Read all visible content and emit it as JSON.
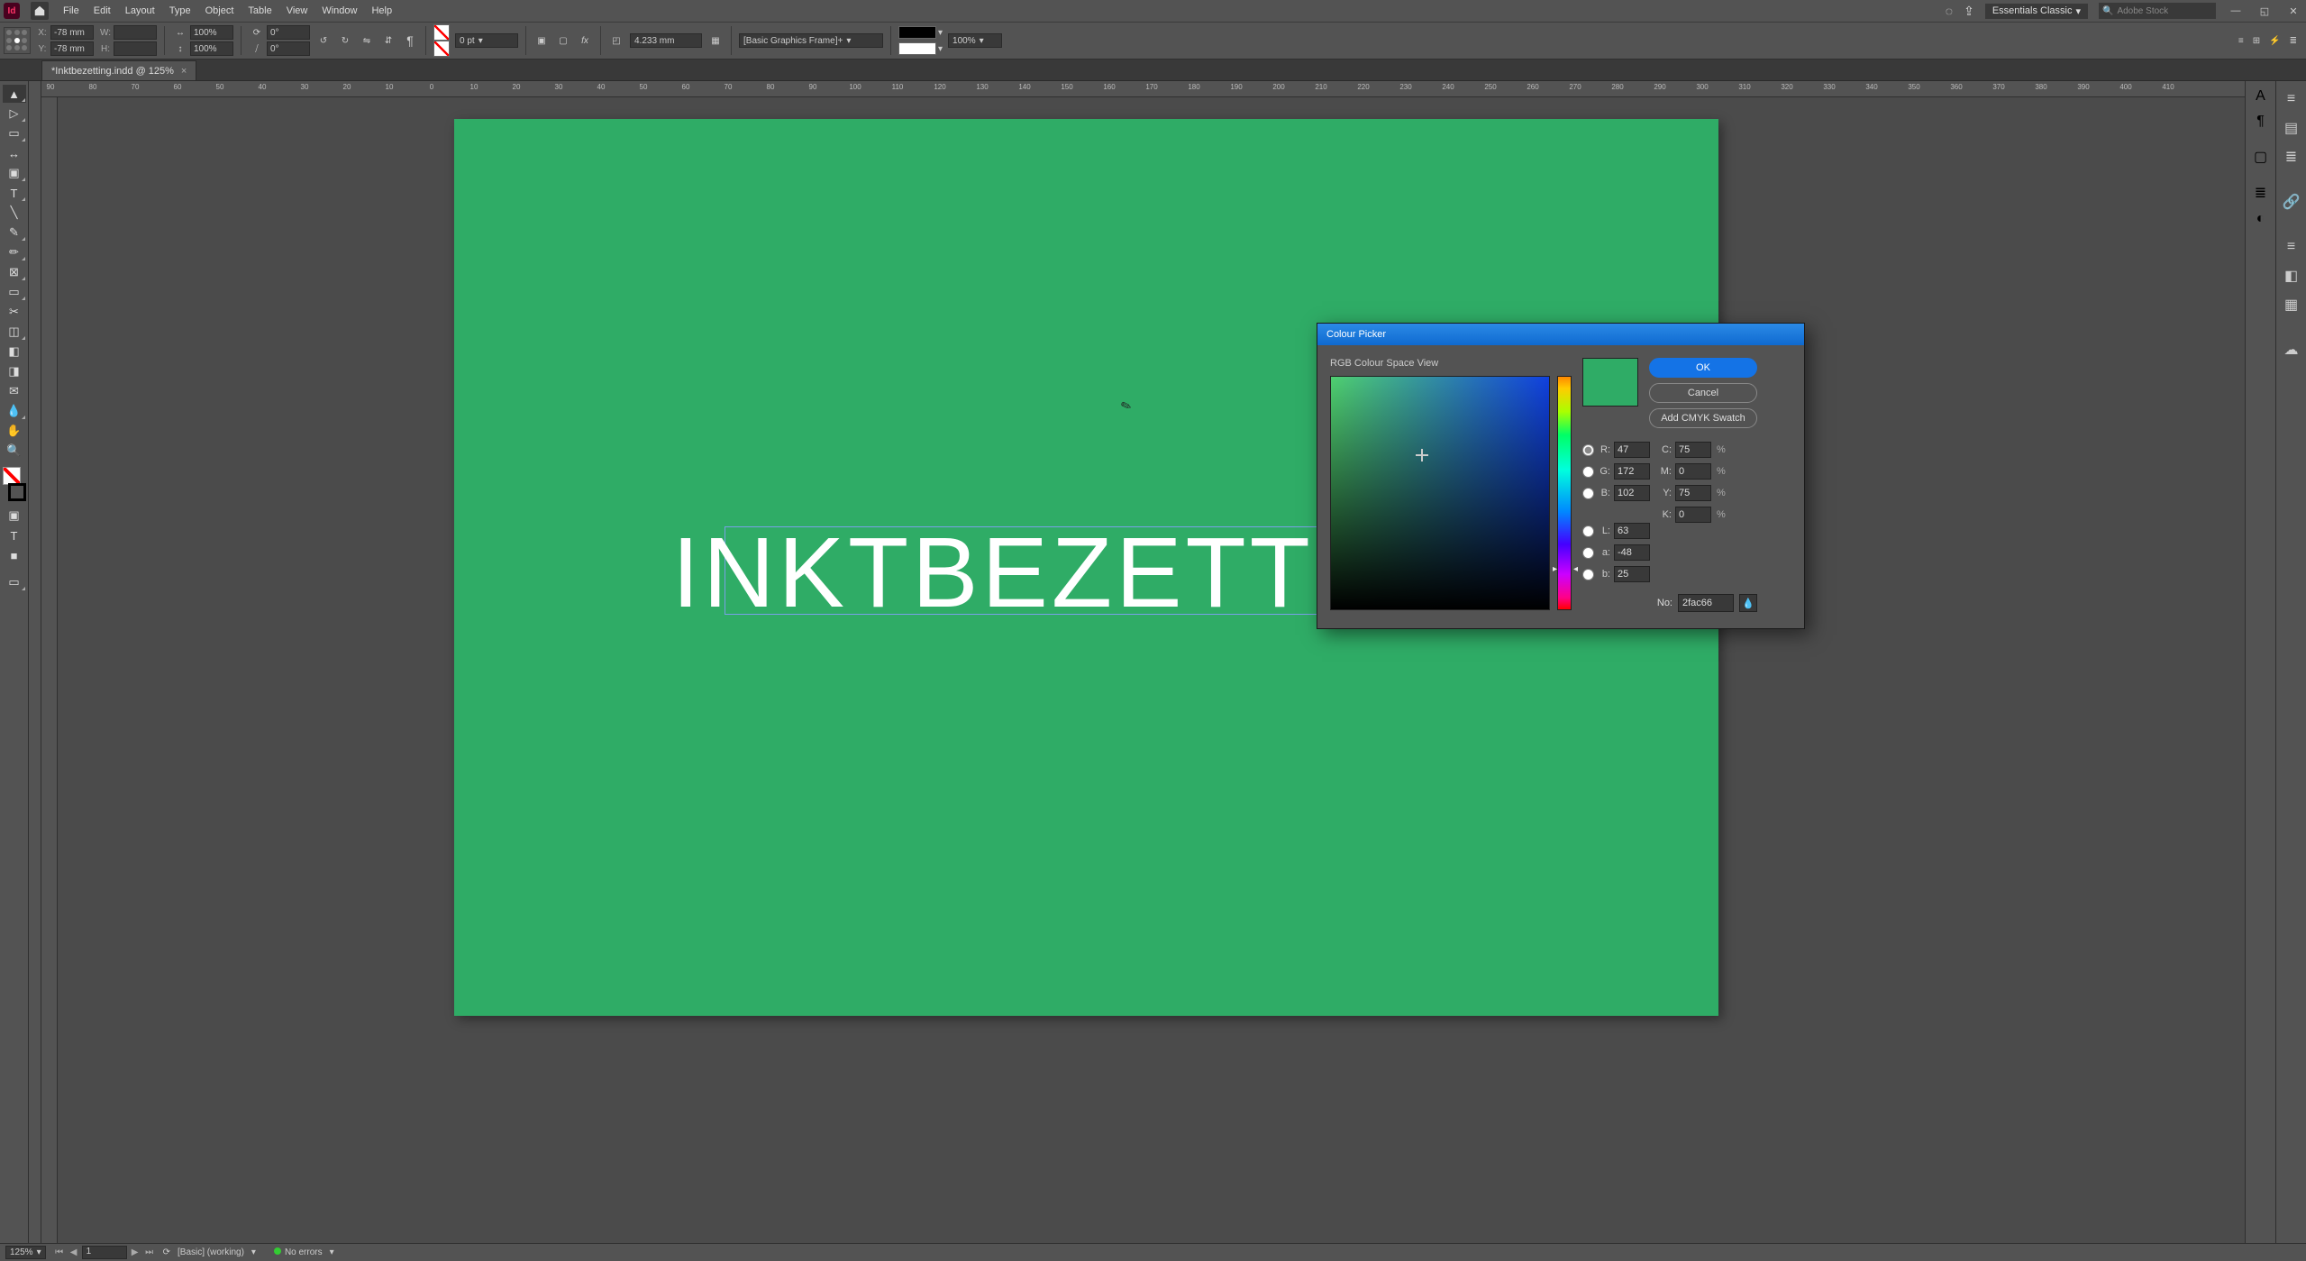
{
  "menu": {
    "items": [
      "File",
      "Edit",
      "Layout",
      "Type",
      "Object",
      "Table",
      "View",
      "Window",
      "Help"
    ],
    "workspace": "Essentials Classic",
    "search_placeholder": "Adobe Stock"
  },
  "controlbar": {
    "x": "-78 mm",
    "y": "-78 mm",
    "w": "",
    "h": "",
    "scale_x": "100%",
    "scale_y": "100%",
    "rotate": "0°",
    "shear": "0°",
    "stroke_weight": "0 pt",
    "corner_radius": "4.233 mm",
    "opacity": "100%",
    "object_style": "[Basic Graphics Frame]+"
  },
  "document": {
    "tab_title": "*Inktbezetting.indd @ 125%",
    "page_text": "INKTBEZETTING"
  },
  "ruler_values": [
    "90",
    "80",
    "70",
    "60",
    "50",
    "40",
    "30",
    "20",
    "10",
    "0",
    "10",
    "20",
    "30",
    "40",
    "50",
    "60",
    "70",
    "80",
    "90",
    "100",
    "110",
    "120",
    "130",
    "140",
    "150",
    "160",
    "170",
    "180",
    "190",
    "200",
    "210",
    "220",
    "230",
    "240",
    "250",
    "260",
    "270",
    "280",
    "290",
    "300",
    "310",
    "320",
    "330",
    "340",
    "350",
    "360",
    "370",
    "380",
    "390",
    "400",
    "410"
  ],
  "colour_picker": {
    "title": "Colour Picker",
    "space_label": "RGB Colour Space View",
    "buttons": {
      "ok": "OK",
      "cancel": "Cancel",
      "add_swatch": "Add CMYK Swatch"
    },
    "rgb": {
      "r": "47",
      "g": "172",
      "b": "102"
    },
    "lab": {
      "l": "63",
      "a": "-48",
      "b": "25"
    },
    "cmyk": {
      "c": "75",
      "m": "0",
      "y": "75",
      "k": "0"
    },
    "hex_label": "No:",
    "hex": "2fac66",
    "preview_new": "#2fac66",
    "preview_old": "#2fac66"
  },
  "statusbar": {
    "zoom": "125%",
    "page": "1",
    "profile": "[Basic] (working)",
    "errors": "No errors"
  },
  "icons": {
    "search": "search-icon",
    "gear": "gear-icon"
  }
}
